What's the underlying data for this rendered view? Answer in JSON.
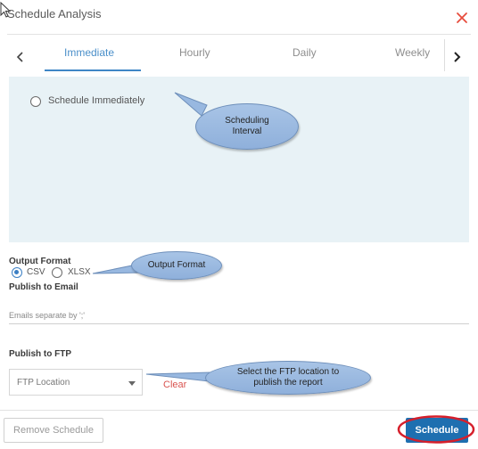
{
  "dialog": {
    "title": "Schedule Analysis"
  },
  "tabs": [
    {
      "label": "Immediate",
      "active": true
    },
    {
      "label": "Hourly",
      "active": false
    },
    {
      "label": "Daily",
      "active": false
    },
    {
      "label": "Weekly",
      "active": false
    }
  ],
  "immediate": {
    "radio_label": "Schedule Immediately"
  },
  "output": {
    "heading": "Output Format",
    "options": [
      {
        "label": "CSV",
        "selected": true
      },
      {
        "label": "XLSX",
        "selected": false
      }
    ]
  },
  "email": {
    "heading": "Publish to Email",
    "placeholder": "Emails separate by ';'"
  },
  "ftp": {
    "heading": "Publish to FTP",
    "select_value": "FTP Location",
    "clear_label": "Clear"
  },
  "annotations": {
    "scheduling_interval": "Scheduling Interval",
    "output_format": "Output Format",
    "ftp_note": "Select the FTP location to publish the report"
  },
  "buttons": {
    "remove_label": "Remove Schedule",
    "schedule_label": "Schedule"
  },
  "icons": [
    "cursor-icon",
    "close-icon",
    "chevron-left-icon",
    "chevron-right-icon",
    "chevron-down-icon"
  ],
  "colors": {
    "accent": "#3f86c6",
    "close": "#e74c3c",
    "clear": "#d9534f",
    "primary_button": "#1e6fb0",
    "highlight_ring": "#d61f2b"
  }
}
